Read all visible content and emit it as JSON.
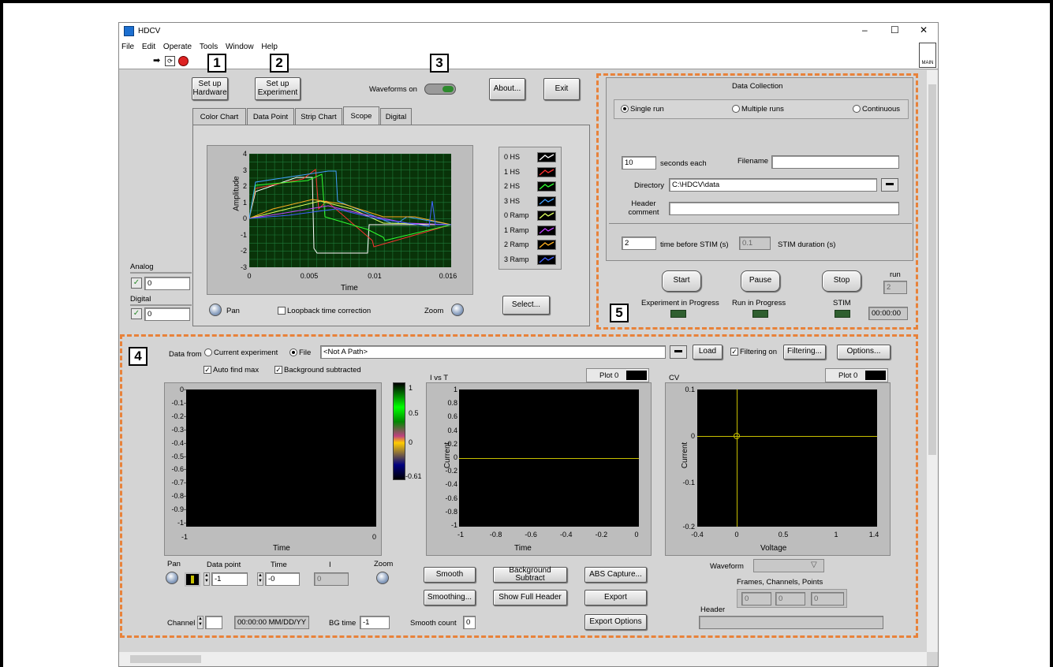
{
  "window": {
    "title": "HDCV",
    "minimize": "–",
    "maximize": "☐",
    "close": "✕"
  },
  "menu": [
    "File",
    "Edit",
    "Operate",
    "Tools",
    "Window",
    "Help"
  ],
  "callouts": [
    "1",
    "2",
    "3",
    "4",
    "5"
  ],
  "top": {
    "setup_hw": "Set up Hardware",
    "setup_exp": "Set up Experiment",
    "waveforms_on": "Waveforms on",
    "about": "About...",
    "exit": "Exit"
  },
  "tabs": [
    "Color Chart",
    "Data Point",
    "Strip Chart",
    "Scope",
    "Digital"
  ],
  "scope": {
    "ylabel": "Amplitude",
    "xlabel": "Time",
    "yticks": [
      "4",
      "3",
      "2",
      "1",
      "0",
      "-1",
      "-2",
      "-3"
    ],
    "xticks": [
      "0",
      "0.005",
      "0.01",
      "0.016"
    ],
    "legend": [
      {
        "label": "0 HS",
        "color": "#ffffff"
      },
      {
        "label": "1 HS",
        "color": "#ff3030"
      },
      {
        "label": "2 HS",
        "color": "#30ff30"
      },
      {
        "label": "3 HS",
        "color": "#40a0ff"
      },
      {
        "label": "0 Ramp",
        "color": "#e0ff60"
      },
      {
        "label": "1 Ramp",
        "color": "#c040ff"
      },
      {
        "label": "2 Ramp",
        "color": "#ffb020"
      },
      {
        "label": "3 Ramp",
        "color": "#4060ff"
      }
    ],
    "pan": "Pan",
    "loopback": "Loopback time correction",
    "zoom": "Zoom",
    "select": "Select..."
  },
  "io": {
    "analog_label": "Analog",
    "analog_value": "0",
    "digital_label": "Digital",
    "digital_value": "0"
  },
  "collection": {
    "title": "Data Collection",
    "single": "Single run",
    "multiple": "Multiple runs",
    "continuous": "Continuous",
    "seconds_value": "10",
    "seconds_label": "seconds each",
    "filename_label": "Filename",
    "filename_value": "",
    "directory_label": "Directory",
    "directory_value": "C:\\HDCV\\data",
    "header_label": "Header comment",
    "header_value": "",
    "time_before_value": "2",
    "time_before_label": "time before STIM (s)",
    "stim_dur_value": "0.1",
    "stim_dur_label": "STIM duration (s)",
    "start": "Start",
    "pause": "Pause",
    "stop": "Stop",
    "run_label": "run",
    "run_value": "2",
    "exp_progress": "Experiment in Progress",
    "run_progress": "Run in Progress",
    "stim": "STIM",
    "clock": "00:00:00"
  },
  "analysis": {
    "data_from": "Data from",
    "current_exp": "Current experiment",
    "file": "File",
    "path": "<Not A Path>",
    "load": "Load",
    "filtering_on": "Filtering on",
    "filtering": "Filtering...",
    "options": "Options...",
    "auto_find_max": "Auto find max",
    "bg_subtracted": "Background subtracted",
    "color_yticks": [
      "0-",
      "-0.1-",
      "-0.2-",
      "-0.3-",
      "-0.4-",
      "-0.5-",
      "-0.6-",
      "-0.7-",
      "-0.8-",
      "-0.9-",
      "-1-"
    ],
    "color_xticks": [
      "-1",
      "0"
    ],
    "color_xlabel": "Time",
    "scale_ticks": [
      "1",
      "0.5",
      "0",
      "-0.61"
    ],
    "ivt_title": "I vs T",
    "ivt_plot": "Plot 0",
    "ivt_ylabel": "Current",
    "ivt_xlabel": "Time",
    "ivt_yticks": [
      "1",
      "0.8",
      "0.6",
      "0.4",
      "0.2",
      "0",
      "-0.2",
      "-0.4",
      "-0.6",
      "-0.8",
      "-1"
    ],
    "ivt_xticks": [
      "-1",
      "-0.8",
      "-0.6",
      "-0.4",
      "-0.2",
      "0"
    ],
    "cv_title": "CV",
    "cv_plot": "Plot 0",
    "cv_ylabel": "Current",
    "cv_xlabel": "Voltage",
    "cv_yticks": [
      "0.1",
      "0",
      "-0.1",
      "-0.2"
    ],
    "cv_xticks": [
      "-0.4",
      "0",
      "0.5",
      "1",
      "1.4"
    ],
    "pan": "Pan",
    "data_point_label": "Data point",
    "data_point_value": "-1",
    "time_label": "Time",
    "time_value": "-0",
    "i_label": "I",
    "i_value": "0",
    "zoom": "Zoom",
    "smooth": "Smooth",
    "bg_subtract": "Background Subtract",
    "abs_capture": "ABS Capture...",
    "smoothing": "Smoothing...",
    "show_header": "Show Full Header",
    "export": "Export",
    "export_options": "Export Options",
    "waveform_label": "Waveform",
    "fcp_label": "Frames, Channels, Points",
    "fcp_values": [
      "0",
      "0",
      "0"
    ],
    "header_label": "Header",
    "channel_label": "Channel",
    "date_value": "00:00:00  MM/DD/YY",
    "bg_time_label": "BG time",
    "bg_time_value": "-1",
    "smooth_count_label": "Smooth count",
    "smooth_count_value": "0"
  }
}
